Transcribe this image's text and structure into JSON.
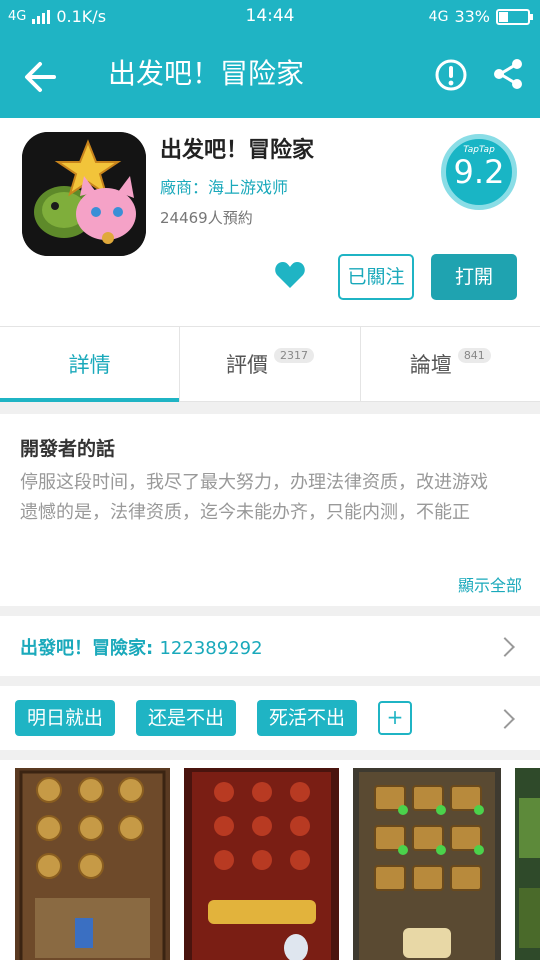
{
  "status_bar": {
    "network": "4G",
    "speed": "0.1K/s",
    "time": "14:44",
    "network_right": "4G",
    "battery": "33%"
  },
  "app_bar": {
    "title": "出发吧！冒险家"
  },
  "app": {
    "name": "出发吧！冒险家",
    "vendor": "廠商：海上游戏师",
    "reservations": "24469人預約",
    "score_brand": "TapTap",
    "score": "9.2",
    "follow_label": "已關注",
    "open_label": "打開"
  },
  "tabs": [
    {
      "label": "詳情",
      "count": ""
    },
    {
      "label": "評價",
      "count": "2317"
    },
    {
      "label": "論壇",
      "count": "841"
    }
  ],
  "developer": {
    "heading": "開發者的話",
    "text": "停服这段时间，我尽了最大努力，办理法律资质，改进游戏\n遗憾的是，法律资质，迄今未能办齐，只能内测，不能正",
    "more_label": "顯示全部"
  },
  "group": {
    "label": "出發吧！冒險家:",
    "number": "122389292"
  },
  "tags": [
    "明日就出",
    "还是不出",
    "死活不出"
  ],
  "tag_add": "+",
  "colors": {
    "accent": "#1fb4c4",
    "accent_text": "#1aa9bb"
  }
}
